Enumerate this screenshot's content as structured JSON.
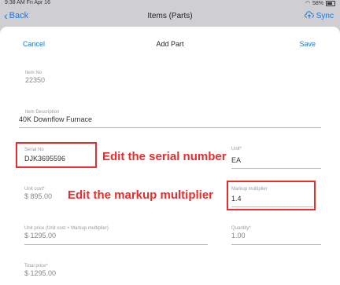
{
  "status_bar": {
    "time": "9:38 AM   Fri Apr 16",
    "battery": "58%"
  },
  "nav": {
    "back_label": "Back",
    "title": "Items (Parts)",
    "sync_label": "Sync"
  },
  "sheet": {
    "cancel_label": "Cancel",
    "title": "Add Part",
    "save_label": "Save"
  },
  "fields": {
    "item_no": {
      "label": "Item No",
      "value": "22350"
    },
    "item_description": {
      "label": "Item Description",
      "value": "40K Downflow Furnace"
    },
    "serial_no": {
      "label": "Serial No",
      "value": "DJK3695596"
    },
    "unit": {
      "label": "Unit*",
      "value": "EA"
    },
    "unit_cost": {
      "label": "Unit cost*",
      "value": "$ 895.00"
    },
    "markup_multiplier": {
      "label": "Markup multiplier",
      "value": "1.4"
    },
    "unit_price": {
      "label": "Unit price (Unit cost × Markup multiplier)",
      "value": "$ 1295.00"
    },
    "quantity": {
      "label": "Quantity*",
      "value": "1.00"
    },
    "total_price": {
      "label": "Total price*",
      "value": "$ 1295.00"
    }
  },
  "annotations": {
    "serial": "Edit the serial number",
    "markup": "Edit the markup multiplier"
  },
  "colors": {
    "accent": "#1877e8",
    "annotation": "#ec2b2b"
  }
}
